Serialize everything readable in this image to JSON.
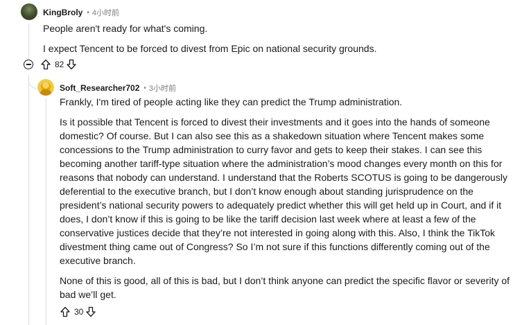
{
  "comments": [
    {
      "author": "KingBroly",
      "time": "4小时前",
      "paragraphs": [
        "People aren't ready for what's coming.",
        "I expect Tencent to be forced to divest from Epic on national security grounds."
      ],
      "score": "82"
    },
    {
      "author": "Soft_Researcher702",
      "time": "3小时前",
      "paragraphs": [
        "Frankly, I'm tired of people acting like they can predict the Trump administration.",
        "Is it possible that Tencent is forced to divest their investments and it goes into the hands of someone domestic? Of course. But I can also see this as a shakedown situation where Tencent makes some concessions to the Trump administration to curry favor and gets to keep their stakes. I can see this becoming another tariff-type situation where the administration’s mood changes every month on this for reasons that nobody can understand. I understand that the Roberts SCOTUS is going to be dangerously deferential to the executive branch, but I don’t know enough about standing jurisprudence on the president’s national security powers to adequately predict whether this will get held up in Court, and if it does, I don’t know if this is going to be like the tariff decision last week where at least a few of the conservative justices decide that they’re not interested in going along with this. Also, I think the TikTok divestment thing came out of Congress? So I’m not sure if this functions differently coming out of the executive branch.",
        "None of this is good, all of this is bad, but I don’t think anyone can predict the specific flavor or severity of bad we’ll get."
      ],
      "score": "30"
    }
  ],
  "icons": {
    "collapse": "collapse-icon",
    "upvote": "upvote-arrow-icon",
    "downvote": "downvote-arrow-icon",
    "separator": "•"
  },
  "colors": {
    "text": "#1a1a1b",
    "meta": "#7c7c7c",
    "thread_line": "#d9dde0"
  }
}
